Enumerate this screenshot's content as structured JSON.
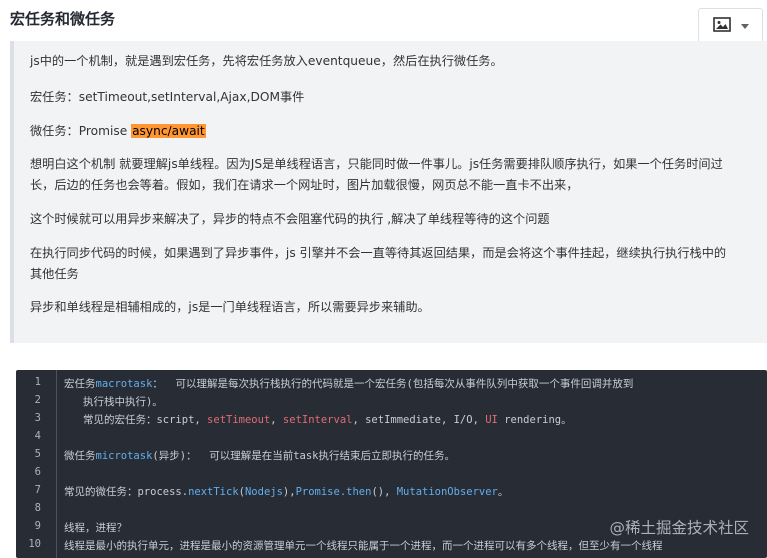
{
  "heading": "宏任务和微任务",
  "toolbar": {
    "image_icon": "image-icon",
    "dropdown_icon": "caret-down-icon"
  },
  "quote": {
    "p1": "js中的一个机制，就是遇到宏任务，先将宏任务放入eventqueue，然后在执行微任务。",
    "p2": "宏任务：setTimeout,setInterval,Ajax,DOM事件",
    "p3_prefix": "微任务：Promise ",
    "p3_highlight": "async/await",
    "p4_line1": "想明白这个机制 就要理解js单线程。因为JS是单线程语言，只能同时做一件事儿。js任务需要排队顺序执行，如果一个任务时间过",
    "p4_line2": "长，后边的任务也会等着。假如，我们在请求一个网址时，图片加载很慢，网页总不能一直卡不出来，",
    "p5": "这个时候就可以用异步来解决了，异步的特点不会阻塞代码的执行 ,解决了单线程等待的这个问题",
    "p6_line1": "在执行同步代码的时候，如果遇到了异步事件，js 引擎并不会一直等待其返回结果，而是会将这个事件挂起，继续执行执行栈中的",
    "p6_line2": "其他任务",
    "p7": "异步和单线程是相辅相成的，js是一门单线程语言，所以需要异步来辅助。"
  },
  "code": {
    "line_numbers": [
      "1",
      "2",
      "3",
      "4",
      "5",
      "6",
      "7",
      "8",
      "9",
      "10"
    ],
    "l1_a": "宏任务",
    "l1_b": "macrotask",
    "l1_c": "：  可以理解是每次执行栈执行的代码就是一个宏任务(包括每次从事件队列中获取一个事件回调并放到",
    "l2": "   执行栈中执行)。",
    "l3_a": "   常见的宏任务：script, ",
    "l3_b": "setTimeout",
    "l3_c": ", ",
    "l3_d": "setInterval",
    "l3_e": ", setImmediate, I/O, ",
    "l3_f": "UI",
    "l3_g": " rendering。",
    "l5_a": "微任务",
    "l5_b": "microtask",
    "l5_c": "(异步)：  可以理解是在当前task执行结束后立即执行的任务。",
    "l7_a": "常见的微任务：process.",
    "l7_b": "nextTick",
    "l7_c": "(",
    "l7_d": "Nodejs",
    "l7_e": "),",
    "l7_f": "Promise.then",
    "l7_g": "(), ",
    "l7_h": "MutationObserver",
    "l7_i": "。",
    "l9": "线程，进程？",
    "l10": "线程是最小的执行单元，进程是最小的资源管理单元一个线程只能属于一个进程，而一个进程可以有多个线程，但至少有一个线程"
  },
  "watermark": "@稀土掘金技术社区"
}
